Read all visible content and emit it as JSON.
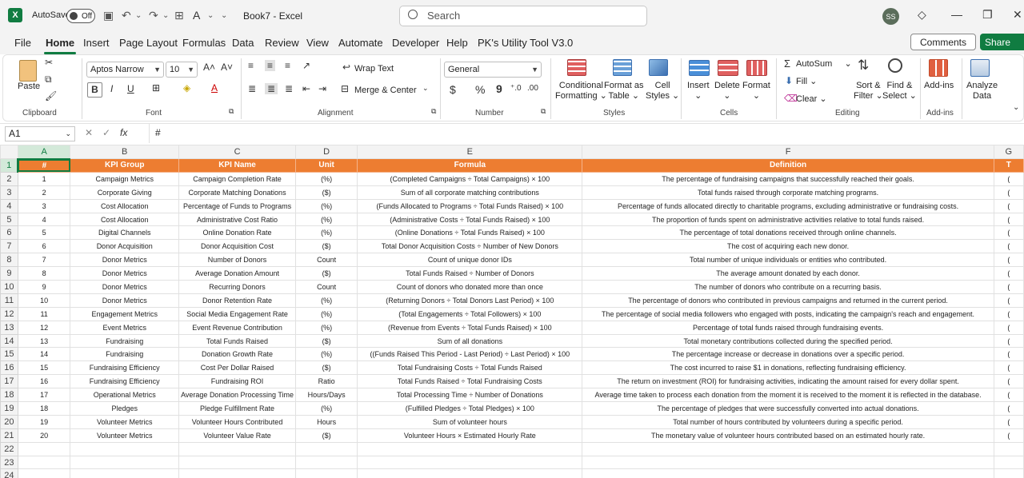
{
  "titlebar": {
    "autosave_label": "AutoSave",
    "autosave_state": "Off",
    "doc_title": "Book7 - Excel",
    "search_placeholder": "Search",
    "avatar_initials": "SS",
    "app_icon": "excel-logo"
  },
  "menu": {
    "tabs": [
      "File",
      "Home",
      "Insert",
      "Page Layout",
      "Formulas",
      "Data",
      "Review",
      "View",
      "Automate",
      "Developer",
      "Help",
      "PK's Utility Tool V3.0"
    ],
    "active_tab": "Home",
    "comments_label": "Comments",
    "share_label": "Share"
  },
  "ribbon": {
    "clipboard": {
      "label": "Clipboard",
      "paste": "Paste"
    },
    "font": {
      "label": "Font",
      "name": "Aptos Narrow",
      "size": "10",
      "bold": "B",
      "italic": "I",
      "underline": "U"
    },
    "alignment": {
      "label": "Alignment",
      "wrap": "Wrap Text",
      "merge": "Merge & Center"
    },
    "number": {
      "label": "Number",
      "format": "General",
      "currency": "$",
      "percent": "%",
      "comma": "9"
    },
    "styles": {
      "label": "Styles",
      "conditional": [
        "Conditional",
        "Formatting"
      ],
      "format_table": [
        "Format as",
        "Table"
      ],
      "cell_styles": [
        "Cell",
        "Styles"
      ]
    },
    "cells": {
      "label": "Cells",
      "insert": "Insert",
      "delete": "Delete",
      "format": "Format"
    },
    "editing": {
      "label": "Editing",
      "autosum": "AutoSum",
      "fill": "Fill",
      "clear": "Clear",
      "sort": [
        "Sort &",
        "Filter"
      ],
      "find": [
        "Find &",
        "Select"
      ]
    },
    "addins": {
      "label": "Add-ins",
      "addins": "Add-ins"
    },
    "analyze": {
      "label": "Analyze",
      "data": "Data"
    }
  },
  "formula_bar": {
    "name_box": "A1",
    "fx": "fx",
    "content": "#"
  },
  "grid": {
    "columns": [
      "A",
      "B",
      "C",
      "D",
      "E",
      "F",
      "G"
    ],
    "selected_cell": "A1",
    "header_row": [
      "#",
      "KPI Group",
      "KPI Name",
      "Unit",
      "Formula",
      "Definition",
      "T"
    ],
    "rows": [
      [
        "1",
        "Campaign Metrics",
        "Campaign Completion Rate",
        "(%)",
        "(Completed Campaigns ÷ Total Campaigns) × 100",
        "The percentage of fundraising campaigns that successfully reached their goals.",
        "("
      ],
      [
        "2",
        "Corporate Giving",
        "Corporate Matching Donations",
        "($)",
        "Sum of all corporate matching contributions",
        "Total funds raised through corporate matching programs.",
        "("
      ],
      [
        "3",
        "Cost Allocation",
        "Percentage of Funds to Programs",
        "(%)",
        "(Funds Allocated to Programs ÷ Total Funds Raised) × 100",
        "Percentage of funds allocated directly to charitable programs, excluding administrative or fundraising costs.",
        "("
      ],
      [
        "4",
        "Cost Allocation",
        "Administrative Cost Ratio",
        "(%)",
        "(Administrative Costs ÷ Total Funds Raised) × 100",
        "The proportion of funds spent on administrative activities relative to total funds raised.",
        "("
      ],
      [
        "5",
        "Digital Channels",
        "Online Donation Rate",
        "(%)",
        "(Online Donations ÷ Total Funds Raised) × 100",
        "The percentage of total donations received through online channels.",
        "("
      ],
      [
        "6",
        "Donor Acquisition",
        "Donor Acquisition Cost",
        "($)",
        "Total Donor Acquisition Costs ÷ Number of New Donors",
        "The cost of acquiring each new donor.",
        "("
      ],
      [
        "7",
        "Donor Metrics",
        "Number of Donors",
        "Count",
        "Count of unique donor IDs",
        "Total number of unique individuals or entities who contributed.",
        "("
      ],
      [
        "8",
        "Donor Metrics",
        "Average Donation Amount",
        "($)",
        "Total Funds Raised ÷ Number of Donors",
        "The average amount donated by each donor.",
        "("
      ],
      [
        "9",
        "Donor Metrics",
        "Recurring Donors",
        "Count",
        "Count of donors who donated more than once",
        "The number of donors who contribute on a recurring basis.",
        "("
      ],
      [
        "10",
        "Donor Metrics",
        "Donor Retention Rate",
        "(%)",
        "(Returning Donors ÷ Total Donors Last Period) × 100",
        "The percentage of donors who contributed in previous campaigns and returned in the current period.",
        "("
      ],
      [
        "11",
        "Engagement Metrics",
        "Social Media Engagement Rate",
        "(%)",
        "(Total Engagements ÷ Total Followers) × 100",
        "The percentage of social media followers who engaged with posts, indicating the campaign's reach and engagement.",
        "("
      ],
      [
        "12",
        "Event Metrics",
        "Event Revenue Contribution",
        "(%)",
        "(Revenue from Events ÷ Total Funds Raised) × 100",
        "Percentage of total funds raised through fundraising events.",
        "("
      ],
      [
        "13",
        "Fundraising",
        "Total Funds Raised",
        "($)",
        "Sum of all donations",
        "Total monetary contributions collected during the specified period.",
        "("
      ],
      [
        "14",
        "Fundraising",
        "Donation Growth Rate",
        "(%)",
        "((Funds Raised This Period - Last Period) ÷ Last Period) × 100",
        "The percentage increase or decrease in donations over a specific period.",
        "("
      ],
      [
        "15",
        "Fundraising Efficiency",
        "Cost Per Dollar Raised",
        "($)",
        "Total Fundraising Costs ÷ Total Funds Raised",
        "The cost incurred to raise $1 in donations, reflecting fundraising efficiency.",
        "("
      ],
      [
        "16",
        "Fundraising Efficiency",
        "Fundraising ROI",
        "Ratio",
        "Total Funds Raised ÷ Total Fundraising Costs",
        "The return on investment (ROI) for fundraising activities, indicating the amount raised for every dollar spent.",
        "("
      ],
      [
        "17",
        "Operational Metrics",
        "Average Donation Processing Time",
        "Hours/Days",
        "Total Processing Time ÷ Number of Donations",
        "Average time taken to process each donation from the moment it is received to the moment it is reflected in the database.",
        "("
      ],
      [
        "18",
        "Pledges",
        "Pledge Fulfillment Rate",
        "(%)",
        "(Fulfilled Pledges ÷ Total Pledges) × 100",
        "The percentage of pledges that were successfully converted into actual donations.",
        "("
      ],
      [
        "19",
        "Volunteer Metrics",
        "Volunteer Hours Contributed",
        "Hours",
        "Sum of volunteer hours",
        "Total number of hours contributed by volunteers during a specific period.",
        "("
      ],
      [
        "20",
        "Volunteer Metrics",
        "Volunteer Value Rate",
        "($)",
        "Volunteer Hours × Estimated Hourly Rate",
        "The monetary value of volunteer hours contributed based on an estimated hourly rate.",
        "("
      ]
    ],
    "empty_rows": [
      "22",
      "23",
      "24"
    ]
  },
  "colors": {
    "accent": "#107c41",
    "header_fill": "#ed7d31",
    "header_text": "#ffffff"
  }
}
